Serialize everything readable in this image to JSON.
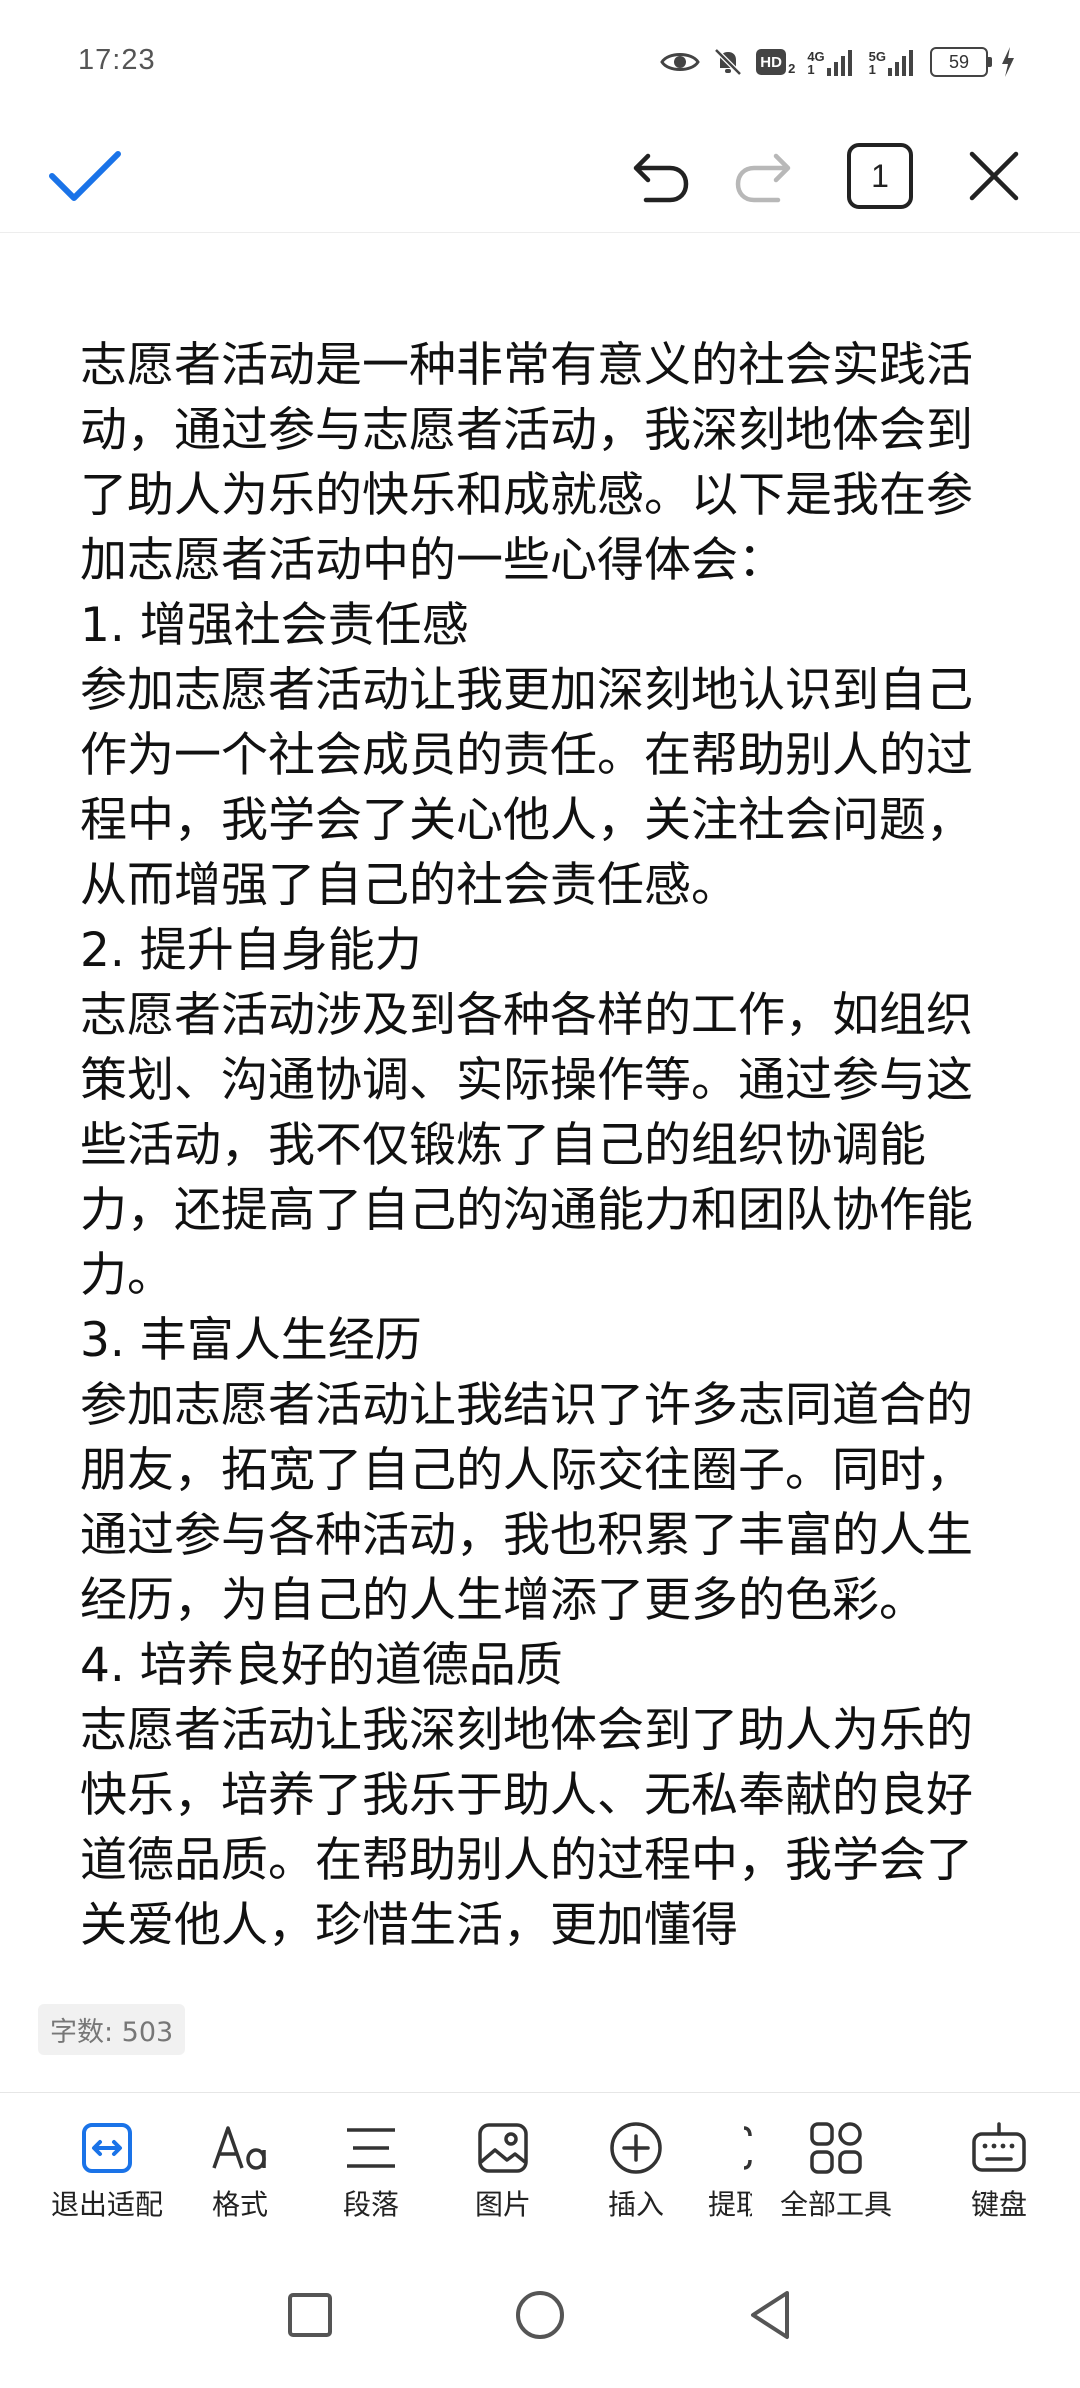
{
  "status_bar": {
    "time": "17:23",
    "hd_label": "HD",
    "hd_sub": "2",
    "net1_label": "4G",
    "net1_sup": "1",
    "net2_label": "5G",
    "net2_sup": "1",
    "battery": "59",
    "icons": [
      "eye-icon",
      "bell-off-icon",
      "hd-icon",
      "signal-4g-icon",
      "signal-5g-icon",
      "battery-icon",
      "charging-icon"
    ]
  },
  "toolbar": {
    "page_count": "1",
    "icons": [
      "check-icon",
      "undo-icon",
      "redo-icon",
      "close-icon"
    ],
    "accent": "#1a73e8"
  },
  "document": {
    "paragraphs": [
      "志愿者活动是一种非常有意义的社会实践活动，通过参与志愿者活动，我深刻地体会到了助人为乐的快乐和成就感。以下是我在参加志愿者活动中的一些心得体会：",
      "1. 增强社会责任感",
      "参加志愿者活动让我更加深刻地认识到自己作为一个社会成员的责任。在帮助别人的过程中，我学会了关心他人，关注社会问题，从而增强了自己的社会责任感。",
      "2. 提升自身能力",
      "志愿者活动涉及到各种各样的工作，如组织策划、沟通协调、实际操作等。通过参与这些活动，我不仅锻炼了自己的组织协调能力，还提高了自己的沟通能力和团队协作能力。",
      "3. 丰富人生经历",
      "参加志愿者活动让我结识了许多志同道合的朋友，拓宽了自己的人际交往圈子。同时，通过参与各种活动，我也积累了丰富的人生经历，为自己的人生增添了更多的色彩。",
      "4. 培养良好的道德品质",
      "志愿者活动让我深刻地体会到了助人为乐的快乐，培养了我乐于助人、无私奉献的良好道德品质。在帮助别人的过程中，我学会了关爱他人，珍惜生活，更加懂得"
    ],
    "word_count": "字数: 503"
  },
  "bottom_tools": [
    {
      "label": "退出适配",
      "icon": "exit-fit-icon"
    },
    {
      "label": "格式",
      "icon": "format-icon"
    },
    {
      "label": "段落",
      "icon": "paragraph-icon"
    },
    {
      "label": "图片",
      "icon": "image-icon"
    },
    {
      "label": "插入",
      "icon": "insert-icon"
    },
    {
      "label": "提取",
      "icon": "extract-icon"
    },
    {
      "label": "全部工具",
      "icon": "all-tools-icon"
    },
    {
      "label": "键盘",
      "icon": "keyboard-icon"
    }
  ],
  "nav_bar": {
    "icons": [
      "recent-apps-icon",
      "home-icon",
      "back-icon"
    ]
  }
}
